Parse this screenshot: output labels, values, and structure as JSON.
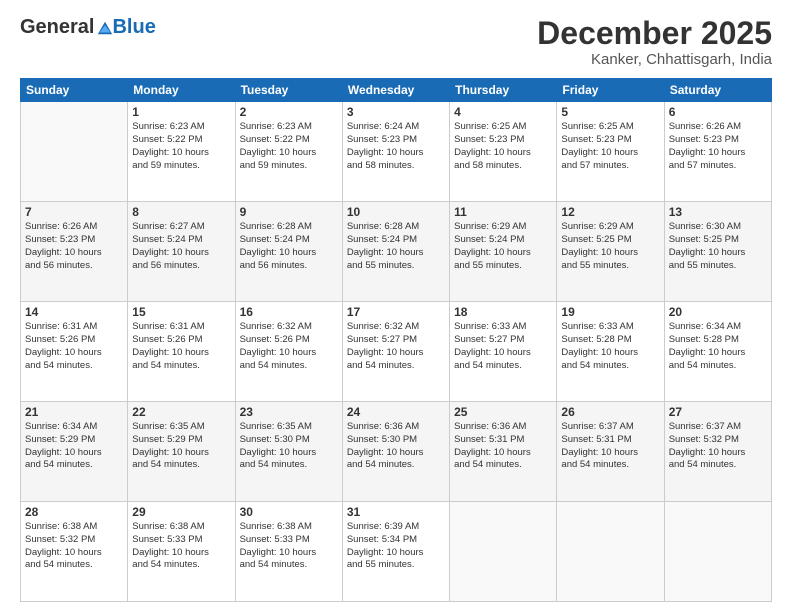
{
  "logo": {
    "general": "General",
    "blue": "Blue"
  },
  "header": {
    "month": "December 2025",
    "location": "Kanker, Chhattisgarh, India"
  },
  "days": [
    "Sunday",
    "Monday",
    "Tuesday",
    "Wednesday",
    "Thursday",
    "Friday",
    "Saturday"
  ],
  "weeks": [
    [
      {
        "date": "",
        "info": ""
      },
      {
        "date": "1",
        "info": "Sunrise: 6:23 AM\nSunset: 5:22 PM\nDaylight: 10 hours\nand 59 minutes."
      },
      {
        "date": "2",
        "info": "Sunrise: 6:23 AM\nSunset: 5:22 PM\nDaylight: 10 hours\nand 59 minutes."
      },
      {
        "date": "3",
        "info": "Sunrise: 6:24 AM\nSunset: 5:23 PM\nDaylight: 10 hours\nand 58 minutes."
      },
      {
        "date": "4",
        "info": "Sunrise: 6:25 AM\nSunset: 5:23 PM\nDaylight: 10 hours\nand 58 minutes."
      },
      {
        "date": "5",
        "info": "Sunrise: 6:25 AM\nSunset: 5:23 PM\nDaylight: 10 hours\nand 57 minutes."
      },
      {
        "date": "6",
        "info": "Sunrise: 6:26 AM\nSunset: 5:23 PM\nDaylight: 10 hours\nand 57 minutes."
      }
    ],
    [
      {
        "date": "7",
        "info": "Sunrise: 6:26 AM\nSunset: 5:23 PM\nDaylight: 10 hours\nand 56 minutes."
      },
      {
        "date": "8",
        "info": "Sunrise: 6:27 AM\nSunset: 5:24 PM\nDaylight: 10 hours\nand 56 minutes."
      },
      {
        "date": "9",
        "info": "Sunrise: 6:28 AM\nSunset: 5:24 PM\nDaylight: 10 hours\nand 56 minutes."
      },
      {
        "date": "10",
        "info": "Sunrise: 6:28 AM\nSunset: 5:24 PM\nDaylight: 10 hours\nand 55 minutes."
      },
      {
        "date": "11",
        "info": "Sunrise: 6:29 AM\nSunset: 5:24 PM\nDaylight: 10 hours\nand 55 minutes."
      },
      {
        "date": "12",
        "info": "Sunrise: 6:29 AM\nSunset: 5:25 PM\nDaylight: 10 hours\nand 55 minutes."
      },
      {
        "date": "13",
        "info": "Sunrise: 6:30 AM\nSunset: 5:25 PM\nDaylight: 10 hours\nand 55 minutes."
      }
    ],
    [
      {
        "date": "14",
        "info": "Sunrise: 6:31 AM\nSunset: 5:26 PM\nDaylight: 10 hours\nand 54 minutes."
      },
      {
        "date": "15",
        "info": "Sunrise: 6:31 AM\nSunset: 5:26 PM\nDaylight: 10 hours\nand 54 minutes."
      },
      {
        "date": "16",
        "info": "Sunrise: 6:32 AM\nSunset: 5:26 PM\nDaylight: 10 hours\nand 54 minutes."
      },
      {
        "date": "17",
        "info": "Sunrise: 6:32 AM\nSunset: 5:27 PM\nDaylight: 10 hours\nand 54 minutes."
      },
      {
        "date": "18",
        "info": "Sunrise: 6:33 AM\nSunset: 5:27 PM\nDaylight: 10 hours\nand 54 minutes."
      },
      {
        "date": "19",
        "info": "Sunrise: 6:33 AM\nSunset: 5:28 PM\nDaylight: 10 hours\nand 54 minutes."
      },
      {
        "date": "20",
        "info": "Sunrise: 6:34 AM\nSunset: 5:28 PM\nDaylight: 10 hours\nand 54 minutes."
      }
    ],
    [
      {
        "date": "21",
        "info": "Sunrise: 6:34 AM\nSunset: 5:29 PM\nDaylight: 10 hours\nand 54 minutes."
      },
      {
        "date": "22",
        "info": "Sunrise: 6:35 AM\nSunset: 5:29 PM\nDaylight: 10 hours\nand 54 minutes."
      },
      {
        "date": "23",
        "info": "Sunrise: 6:35 AM\nSunset: 5:30 PM\nDaylight: 10 hours\nand 54 minutes."
      },
      {
        "date": "24",
        "info": "Sunrise: 6:36 AM\nSunset: 5:30 PM\nDaylight: 10 hours\nand 54 minutes."
      },
      {
        "date": "25",
        "info": "Sunrise: 6:36 AM\nSunset: 5:31 PM\nDaylight: 10 hours\nand 54 minutes."
      },
      {
        "date": "26",
        "info": "Sunrise: 6:37 AM\nSunset: 5:31 PM\nDaylight: 10 hours\nand 54 minutes."
      },
      {
        "date": "27",
        "info": "Sunrise: 6:37 AM\nSunset: 5:32 PM\nDaylight: 10 hours\nand 54 minutes."
      }
    ],
    [
      {
        "date": "28",
        "info": "Sunrise: 6:38 AM\nSunset: 5:32 PM\nDaylight: 10 hours\nand 54 minutes."
      },
      {
        "date": "29",
        "info": "Sunrise: 6:38 AM\nSunset: 5:33 PM\nDaylight: 10 hours\nand 54 minutes."
      },
      {
        "date": "30",
        "info": "Sunrise: 6:38 AM\nSunset: 5:33 PM\nDaylight: 10 hours\nand 54 minutes."
      },
      {
        "date": "31",
        "info": "Sunrise: 6:39 AM\nSunset: 5:34 PM\nDaylight: 10 hours\nand 55 minutes."
      },
      {
        "date": "",
        "info": ""
      },
      {
        "date": "",
        "info": ""
      },
      {
        "date": "",
        "info": ""
      }
    ]
  ]
}
